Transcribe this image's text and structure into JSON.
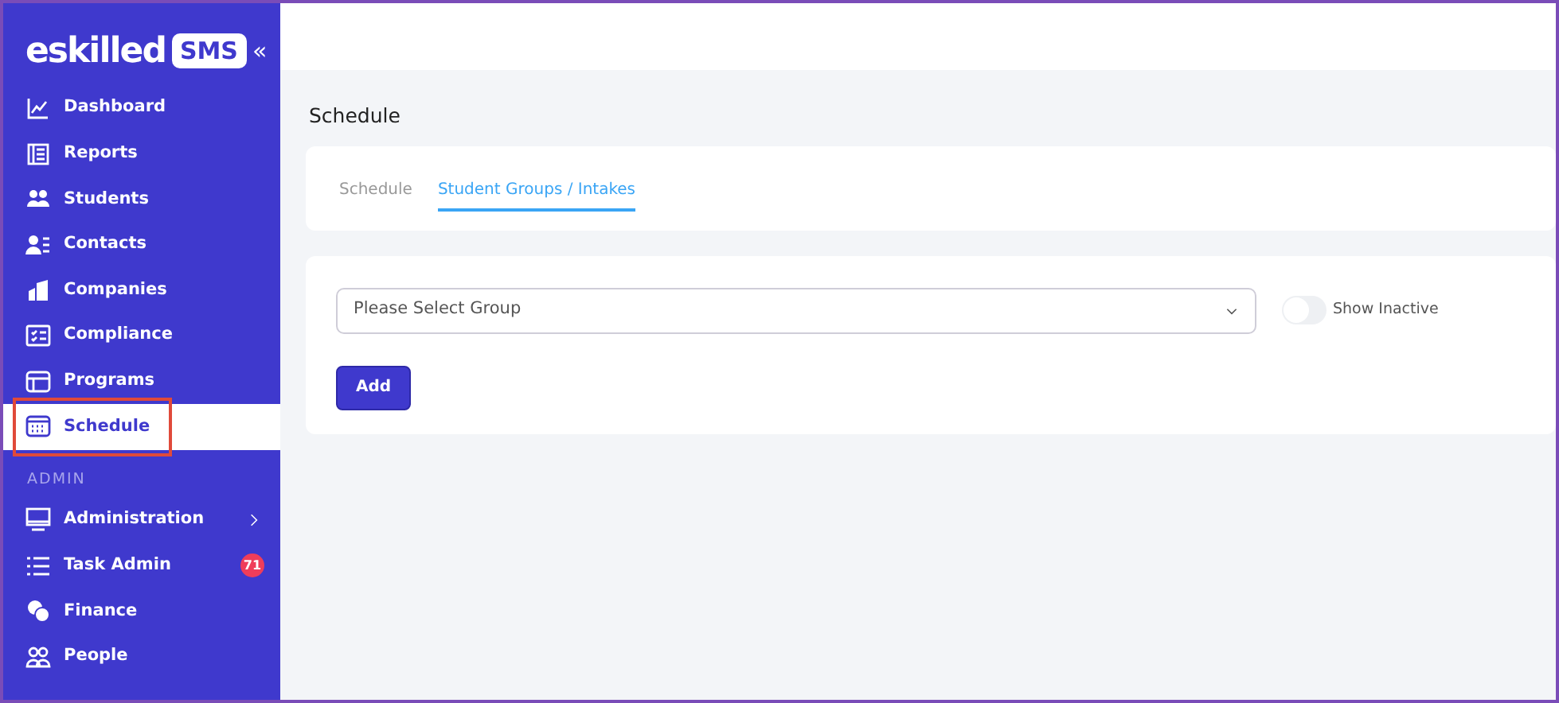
{
  "logo": {
    "brand": "eskilled",
    "badge": "SMS",
    "collapse": "«"
  },
  "sidebar": {
    "items": [
      {
        "label": "Dashboard",
        "selected": false
      },
      {
        "label": "Reports",
        "selected": false
      },
      {
        "label": "Students",
        "selected": false
      },
      {
        "label": "Contacts",
        "selected": false
      },
      {
        "label": "Companies",
        "selected": false
      },
      {
        "label": "Compliance",
        "selected": false
      },
      {
        "label": "Programs",
        "selected": false
      },
      {
        "label": "Schedule",
        "selected": true,
        "highlighted": true
      }
    ],
    "section": "ADMIN",
    "admin_items": [
      {
        "label": "Administration",
        "selected": false,
        "expandable": true
      },
      {
        "label": "Task Admin",
        "selected": false,
        "badge": "71"
      },
      {
        "label": "Finance",
        "selected": false
      },
      {
        "label": "People",
        "selected": false
      }
    ]
  },
  "page_title": "Schedule",
  "tabs": [
    {
      "label": "Schedule",
      "selected": false
    },
    {
      "label": "Student Groups / Intakes",
      "selected": true
    }
  ],
  "group_select": {
    "placeholder": "Please Select Group"
  },
  "show_inactive": {
    "label": "Show Inactive",
    "on": false
  },
  "add_button": "Add"
}
